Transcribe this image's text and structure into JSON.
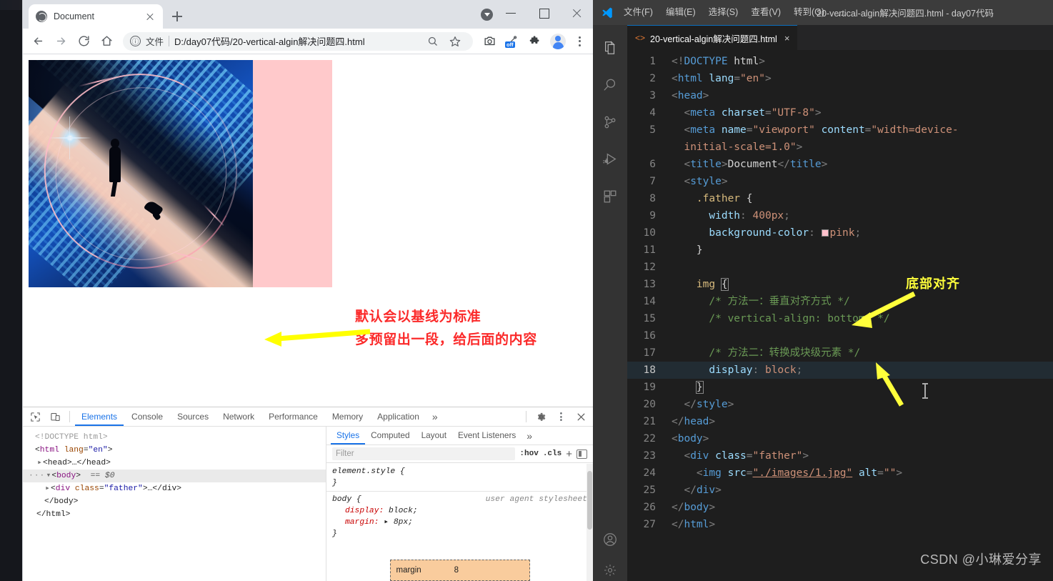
{
  "browser": {
    "tab": {
      "title": "Document",
      "favicon": "globe-icon",
      "close": "×"
    },
    "new_tab": "+",
    "window_controls": {
      "minimize": "–",
      "maximize": "□",
      "close": "×"
    },
    "toolbar": {
      "back": "←",
      "forward": "→",
      "reload": "⟳",
      "home": "⌂",
      "info_icon": "ⓘ",
      "scheme_label": "文件",
      "url": "D:/day07代码/20-vertical-algin解决问题四.html",
      "zoom_icon": "search-zoom-icon",
      "bookmark_icon": "star-icon",
      "screenshot_icon": "camera-icon",
      "ext_off_label": "off",
      "extensions_icon": "puzzle-icon",
      "profile_icon": "avatar-icon",
      "menu_icon": "kebab-icon"
    }
  },
  "page": {
    "annotation_lines": "默认会以基线为标准\n多预留出一段，给后面的内容",
    "annotation_color": "#fb2a2a",
    "arrow_color": "#ffff00",
    "father_bg": "#ffc9cb"
  },
  "devtools": {
    "icons": {
      "inspect": "inspect-element-icon",
      "device": "device-toolbar-icon",
      "settings": "gear-icon",
      "more": "kebab-icon",
      "close": "close-icon"
    },
    "tabs": [
      "Elements",
      "Console",
      "Sources",
      "Network",
      "Performance",
      "Memory",
      "Application"
    ],
    "active_tab": "Elements",
    "overflow": "»",
    "dom": {
      "l1": "<!DOCTYPE html>",
      "l2_tag": "html",
      "l2_attr": "lang",
      "l2_val": "\"en\"",
      "l3": "<head>…</head>",
      "l4_tag": "body",
      "l4_eq": "== $0",
      "l5_tag": "div",
      "l5_attr": "class",
      "l5_val": "\"father\"",
      "l5_tail": "…</div>",
      "l6": "</body>",
      "l7": "</html>"
    },
    "styles": {
      "tabs": [
        "Styles",
        "Computed",
        "Layout",
        "Event Listeners"
      ],
      "active_tab": "Styles",
      "overflow": "»",
      "filter_placeholder": "Filter",
      "hov": ":hov",
      "cls": ".cls",
      "plus": "+",
      "element_style": "element.style {",
      "element_style_close": "}",
      "body_rule": "body {",
      "body_rule_close": "}",
      "ua_label": "user agent stylesheet",
      "prop1": "display:",
      "val1": "block;",
      "prop2": "margin:",
      "val2": "8px;",
      "boxmodel_label": "margin",
      "boxmodel_value": "8"
    }
  },
  "vscode": {
    "logo": "vscode-logo-icon",
    "menus": [
      "文件(F)",
      "编辑(E)",
      "选择(S)",
      "查看(V)",
      "转到(G)"
    ],
    "menu_overflow": "…",
    "window_title": "20-vertical-algin解决问题四.html - day07代码",
    "activity_items": [
      "explorer-icon",
      "search-icon",
      "source-control-icon",
      "run-debug-icon",
      "extensions-icon",
      "account-icon",
      "settings-gear-icon"
    ],
    "tab": {
      "label": "20-vertical-algin解决问题四.html",
      "icon": "html-file-icon",
      "close": "×"
    },
    "annotation": "底部对齐",
    "annotation_color": "#ffff3b",
    "watermark": "CSDN @小琳爱分享",
    "code_lines": [
      {
        "n": 1,
        "indent": 0,
        "tokens": [
          [
            "punct",
            "<!"
          ],
          [
            "tag",
            "DOCTYPE"
          ],
          [
            "txt",
            " html"
          ],
          [
            "punct",
            ">"
          ]
        ]
      },
      {
        "n": 2,
        "indent": 0,
        "tokens": [
          [
            "punct",
            "<"
          ],
          [
            "tag",
            "html"
          ],
          [
            "txt",
            " "
          ],
          [
            "name",
            "lang"
          ],
          [
            "punct",
            "="
          ],
          [
            "str",
            "\"en\""
          ],
          [
            "punct",
            ">"
          ]
        ]
      },
      {
        "n": 3,
        "indent": 0,
        "tokens": [
          [
            "punct",
            "<"
          ],
          [
            "tag",
            "head"
          ],
          [
            "punct",
            ">"
          ]
        ]
      },
      {
        "n": 4,
        "indent": 1,
        "tokens": [
          [
            "punct",
            "<"
          ],
          [
            "tag",
            "meta"
          ],
          [
            "txt",
            " "
          ],
          [
            "name",
            "charset"
          ],
          [
            "punct",
            "="
          ],
          [
            "str",
            "\"UTF-8\""
          ],
          [
            "punct",
            ">"
          ]
        ]
      },
      {
        "n": 5,
        "indent": 1,
        "tokens": [
          [
            "punct",
            "<"
          ],
          [
            "tag",
            "meta"
          ],
          [
            "txt",
            " "
          ],
          [
            "name",
            "name"
          ],
          [
            "punct",
            "="
          ],
          [
            "str",
            "\"viewport\""
          ],
          [
            "txt",
            " "
          ],
          [
            "name",
            "content"
          ],
          [
            "punct",
            "="
          ],
          [
            "str",
            "\"width=device-"
          ]
        ]
      },
      {
        "n": "",
        "indent": 1,
        "wrap": true,
        "tokens": [
          [
            "str",
            "initial-scale=1.0\""
          ],
          [
            "punct",
            ">"
          ]
        ]
      },
      {
        "n": 6,
        "indent": 1,
        "tokens": [
          [
            "punct",
            "<"
          ],
          [
            "tag",
            "title"
          ],
          [
            "punct",
            ">"
          ],
          [
            "txt",
            "Document"
          ],
          [
            "punct",
            "</"
          ],
          [
            "tag",
            "title"
          ],
          [
            "punct",
            ">"
          ]
        ]
      },
      {
        "n": 7,
        "indent": 1,
        "tokens": [
          [
            "punct",
            "<"
          ],
          [
            "tag",
            "style"
          ],
          [
            "punct",
            ">"
          ]
        ]
      },
      {
        "n": 8,
        "indent": 2,
        "tokens": [
          [
            "cls",
            ".father"
          ],
          [
            "txt",
            " "
          ],
          [
            "brace",
            "{"
          ]
        ]
      },
      {
        "n": 9,
        "indent": 3,
        "tokens": [
          [
            "prop",
            "width"
          ],
          [
            "punct",
            ": "
          ],
          [
            "val",
            "400px"
          ],
          [
            "punct",
            ";"
          ]
        ]
      },
      {
        "n": 10,
        "indent": 3,
        "tokens": [
          [
            "prop",
            "background-color"
          ],
          [
            "punct",
            ": "
          ],
          [
            "swatch",
            ""
          ],
          [
            "val",
            "pink"
          ],
          [
            "punct",
            ";"
          ]
        ]
      },
      {
        "n": 11,
        "indent": 2,
        "tokens": [
          [
            "brace",
            "}"
          ]
        ]
      },
      {
        "n": 12,
        "indent": 2,
        "tokens": []
      },
      {
        "n": 13,
        "indent": 2,
        "tokens": [
          [
            "cls",
            "img"
          ],
          [
            "txt",
            " "
          ],
          [
            "bracebox",
            "{"
          ]
        ]
      },
      {
        "n": 14,
        "indent": 3,
        "tokens": [
          [
            "com",
            "/* 方法一：垂直对齐方式 */"
          ]
        ]
      },
      {
        "n": 15,
        "indent": 3,
        "tokens": [
          [
            "com",
            "/* vertical-align: bottom; */"
          ]
        ]
      },
      {
        "n": 16,
        "indent": 3,
        "tokens": []
      },
      {
        "n": 17,
        "indent": 3,
        "tokens": [
          [
            "com",
            "/* 方法二：转换成块级元素 */"
          ]
        ]
      },
      {
        "n": 18,
        "indent": 3,
        "current": true,
        "tokens": [
          [
            "prop",
            "display"
          ],
          [
            "punct",
            ": "
          ],
          [
            "val",
            "block"
          ],
          [
            "punct",
            ";"
          ]
        ]
      },
      {
        "n": 19,
        "indent": 2,
        "tokens": [
          [
            "bracebox",
            "}"
          ]
        ]
      },
      {
        "n": 20,
        "indent": 1,
        "tokens": [
          [
            "punct",
            "</"
          ],
          [
            "tag",
            "style"
          ],
          [
            "punct",
            ">"
          ]
        ]
      },
      {
        "n": 21,
        "indent": 0,
        "tokens": [
          [
            "punct",
            "</"
          ],
          [
            "tag",
            "head"
          ],
          [
            "punct",
            ">"
          ]
        ]
      },
      {
        "n": 22,
        "indent": 0,
        "tokens": [
          [
            "punct",
            "<"
          ],
          [
            "tag",
            "body"
          ],
          [
            "punct",
            ">"
          ]
        ]
      },
      {
        "n": 23,
        "indent": 1,
        "tokens": [
          [
            "punct",
            "<"
          ],
          [
            "tag",
            "div"
          ],
          [
            "txt",
            " "
          ],
          [
            "name",
            "class"
          ],
          [
            "punct",
            "="
          ],
          [
            "str",
            "\"father\""
          ],
          [
            "punct",
            ">"
          ]
        ]
      },
      {
        "n": 24,
        "indent": 2,
        "tokens": [
          [
            "punct",
            "<"
          ],
          [
            "tag",
            "img"
          ],
          [
            "txt",
            " "
          ],
          [
            "name",
            "src"
          ],
          [
            "punct",
            "="
          ],
          [
            "strul",
            "\"./images/1.jpg\""
          ],
          [
            "txt",
            " "
          ],
          [
            "name",
            "alt"
          ],
          [
            "punct",
            "="
          ],
          [
            "str",
            "\"\""
          ],
          [
            "punct",
            ">"
          ]
        ]
      },
      {
        "n": 25,
        "indent": 1,
        "tokens": [
          [
            "punct",
            "</"
          ],
          [
            "tag",
            "div"
          ],
          [
            "punct",
            ">"
          ]
        ]
      },
      {
        "n": 26,
        "indent": 0,
        "tokens": [
          [
            "punct",
            "</"
          ],
          [
            "tag",
            "body"
          ],
          [
            "punct",
            ">"
          ]
        ]
      },
      {
        "n": 27,
        "indent": 0,
        "tokens": [
          [
            "punct",
            "</"
          ],
          [
            "tag",
            "html"
          ],
          [
            "punct",
            ">"
          ]
        ]
      }
    ]
  }
}
